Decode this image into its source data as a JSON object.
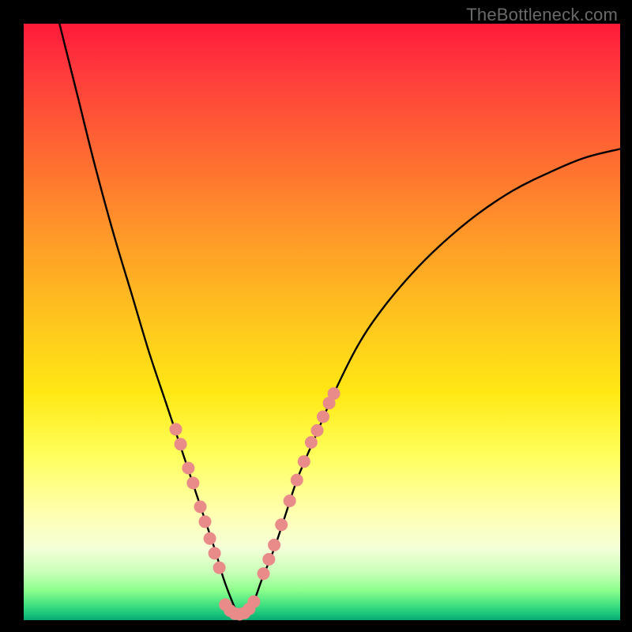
{
  "watermark": "TheBottleneck.com",
  "chart_data": {
    "type": "line",
    "title": "",
    "xlabel": "",
    "ylabel": "",
    "xlim": [
      0,
      100
    ],
    "ylim": [
      0,
      100
    ],
    "note": "Axes are unlabeled in the source image; values are normalized 0–100. Background is a vertical red→green gradient (red = high bottleneck, green = low). The black curve is a V-shaped bottleneck curve with its minimum near x≈36, y≈0. Salmon dot clusters mark segments of the curve on the ascending flanks near the bottom.",
    "series": [
      {
        "name": "bottleneck-curve",
        "x": [
          6,
          9,
          12,
          15,
          18,
          21,
          24,
          26,
          28,
          30,
          32,
          33.5,
          35,
          36,
          37,
          38.5,
          40,
          42,
          44,
          46,
          49,
          52,
          56,
          60,
          65,
          70,
          76,
          82,
          88,
          94,
          100
        ],
        "y": [
          100,
          88,
          76,
          65,
          55,
          45,
          36,
          30,
          24,
          18,
          12,
          7,
          3,
          1,
          1,
          3,
          7,
          12,
          18,
          24,
          31,
          38,
          46,
          52,
          58,
          63,
          68,
          72,
          75,
          77.5,
          79
        ]
      }
    ],
    "marker_clusters": [
      {
        "name": "left-flank-dots",
        "x": [
          25.5,
          26.3,
          27.6,
          28.4,
          29.6,
          30.4,
          31.2,
          32.0,
          32.8
        ],
        "y": [
          32.0,
          29.5,
          25.5,
          23.0,
          19.0,
          16.5,
          13.7,
          11.2,
          8.8
        ]
      },
      {
        "name": "valley-dots",
        "x": [
          33.8,
          34.6,
          35.4,
          36.2,
          37.0,
          37.8,
          38.6
        ],
        "y": [
          2.6,
          1.6,
          1.1,
          1.0,
          1.2,
          1.9,
          3.1
        ]
      },
      {
        "name": "right-flank-dots",
        "x": [
          40.2,
          41.1,
          42.0,
          43.2,
          44.6,
          45.8,
          47.0,
          48.2,
          49.2,
          50.2,
          51.2,
          52.0
        ],
        "y": [
          7.8,
          10.2,
          12.6,
          16.0,
          20.0,
          23.5,
          26.6,
          29.8,
          31.8,
          34.1,
          36.4,
          38.0
        ]
      }
    ],
    "colors": {
      "curve": "#000000",
      "markers": "#e98b89",
      "gradient_top": "#ff1a3a",
      "gradient_bottom": "#0aa873"
    }
  }
}
